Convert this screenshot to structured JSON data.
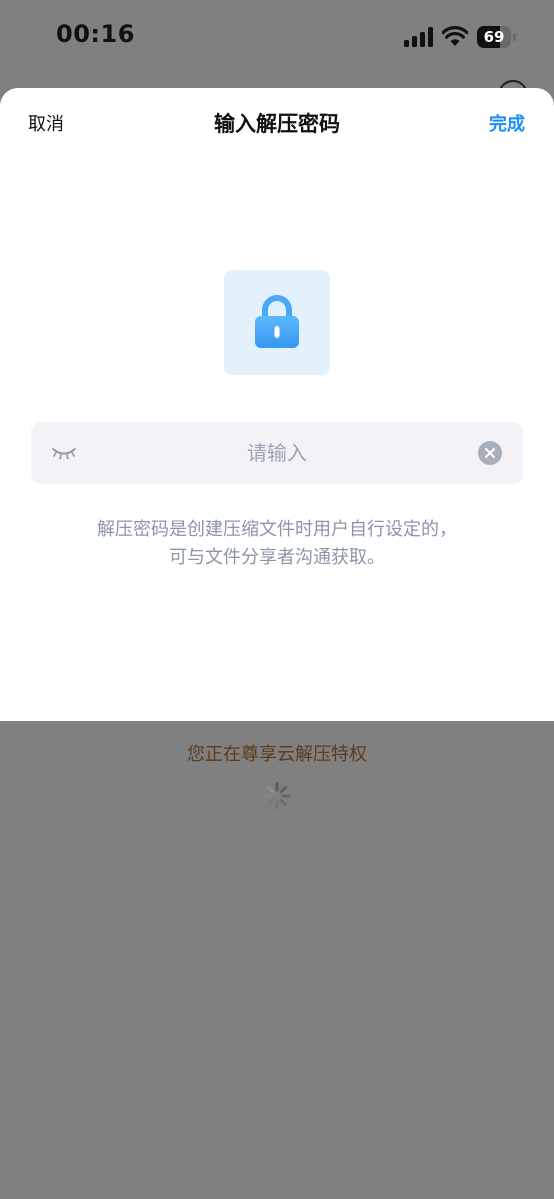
{
  "status_bar": {
    "time": "00:16",
    "battery_level": "69",
    "battery_fraction": 0.69,
    "icons": [
      "signal-icon",
      "wifi-icon",
      "battery-icon"
    ]
  },
  "sheet": {
    "cancel_label": "取消",
    "title": "输入解压密码",
    "done_label": "完成",
    "lock_icon": "lock-icon",
    "password_field": {
      "placeholder": "请输入",
      "value": "",
      "visibility_icon": "eye-closed-icon",
      "clear_icon": "clear-icon"
    },
    "hint": "解压密码是创建压缩文件时用户自行设定的，可与文件分享者沟通获取。"
  },
  "background_page": {
    "privilege_text": "您正在尊享云解压特权",
    "loading_icon": "spinner-icon"
  },
  "colors": {
    "accent": "#1a8cff",
    "lock_blue": "#3fa3f7",
    "lock_tile_bg": "#e3f1fd",
    "input_bg": "#f2f2f7",
    "placeholder": "#9aa3b5",
    "hint": "#8c95a8",
    "privilege_text": "#5e3a19",
    "overlay": "#808080"
  }
}
